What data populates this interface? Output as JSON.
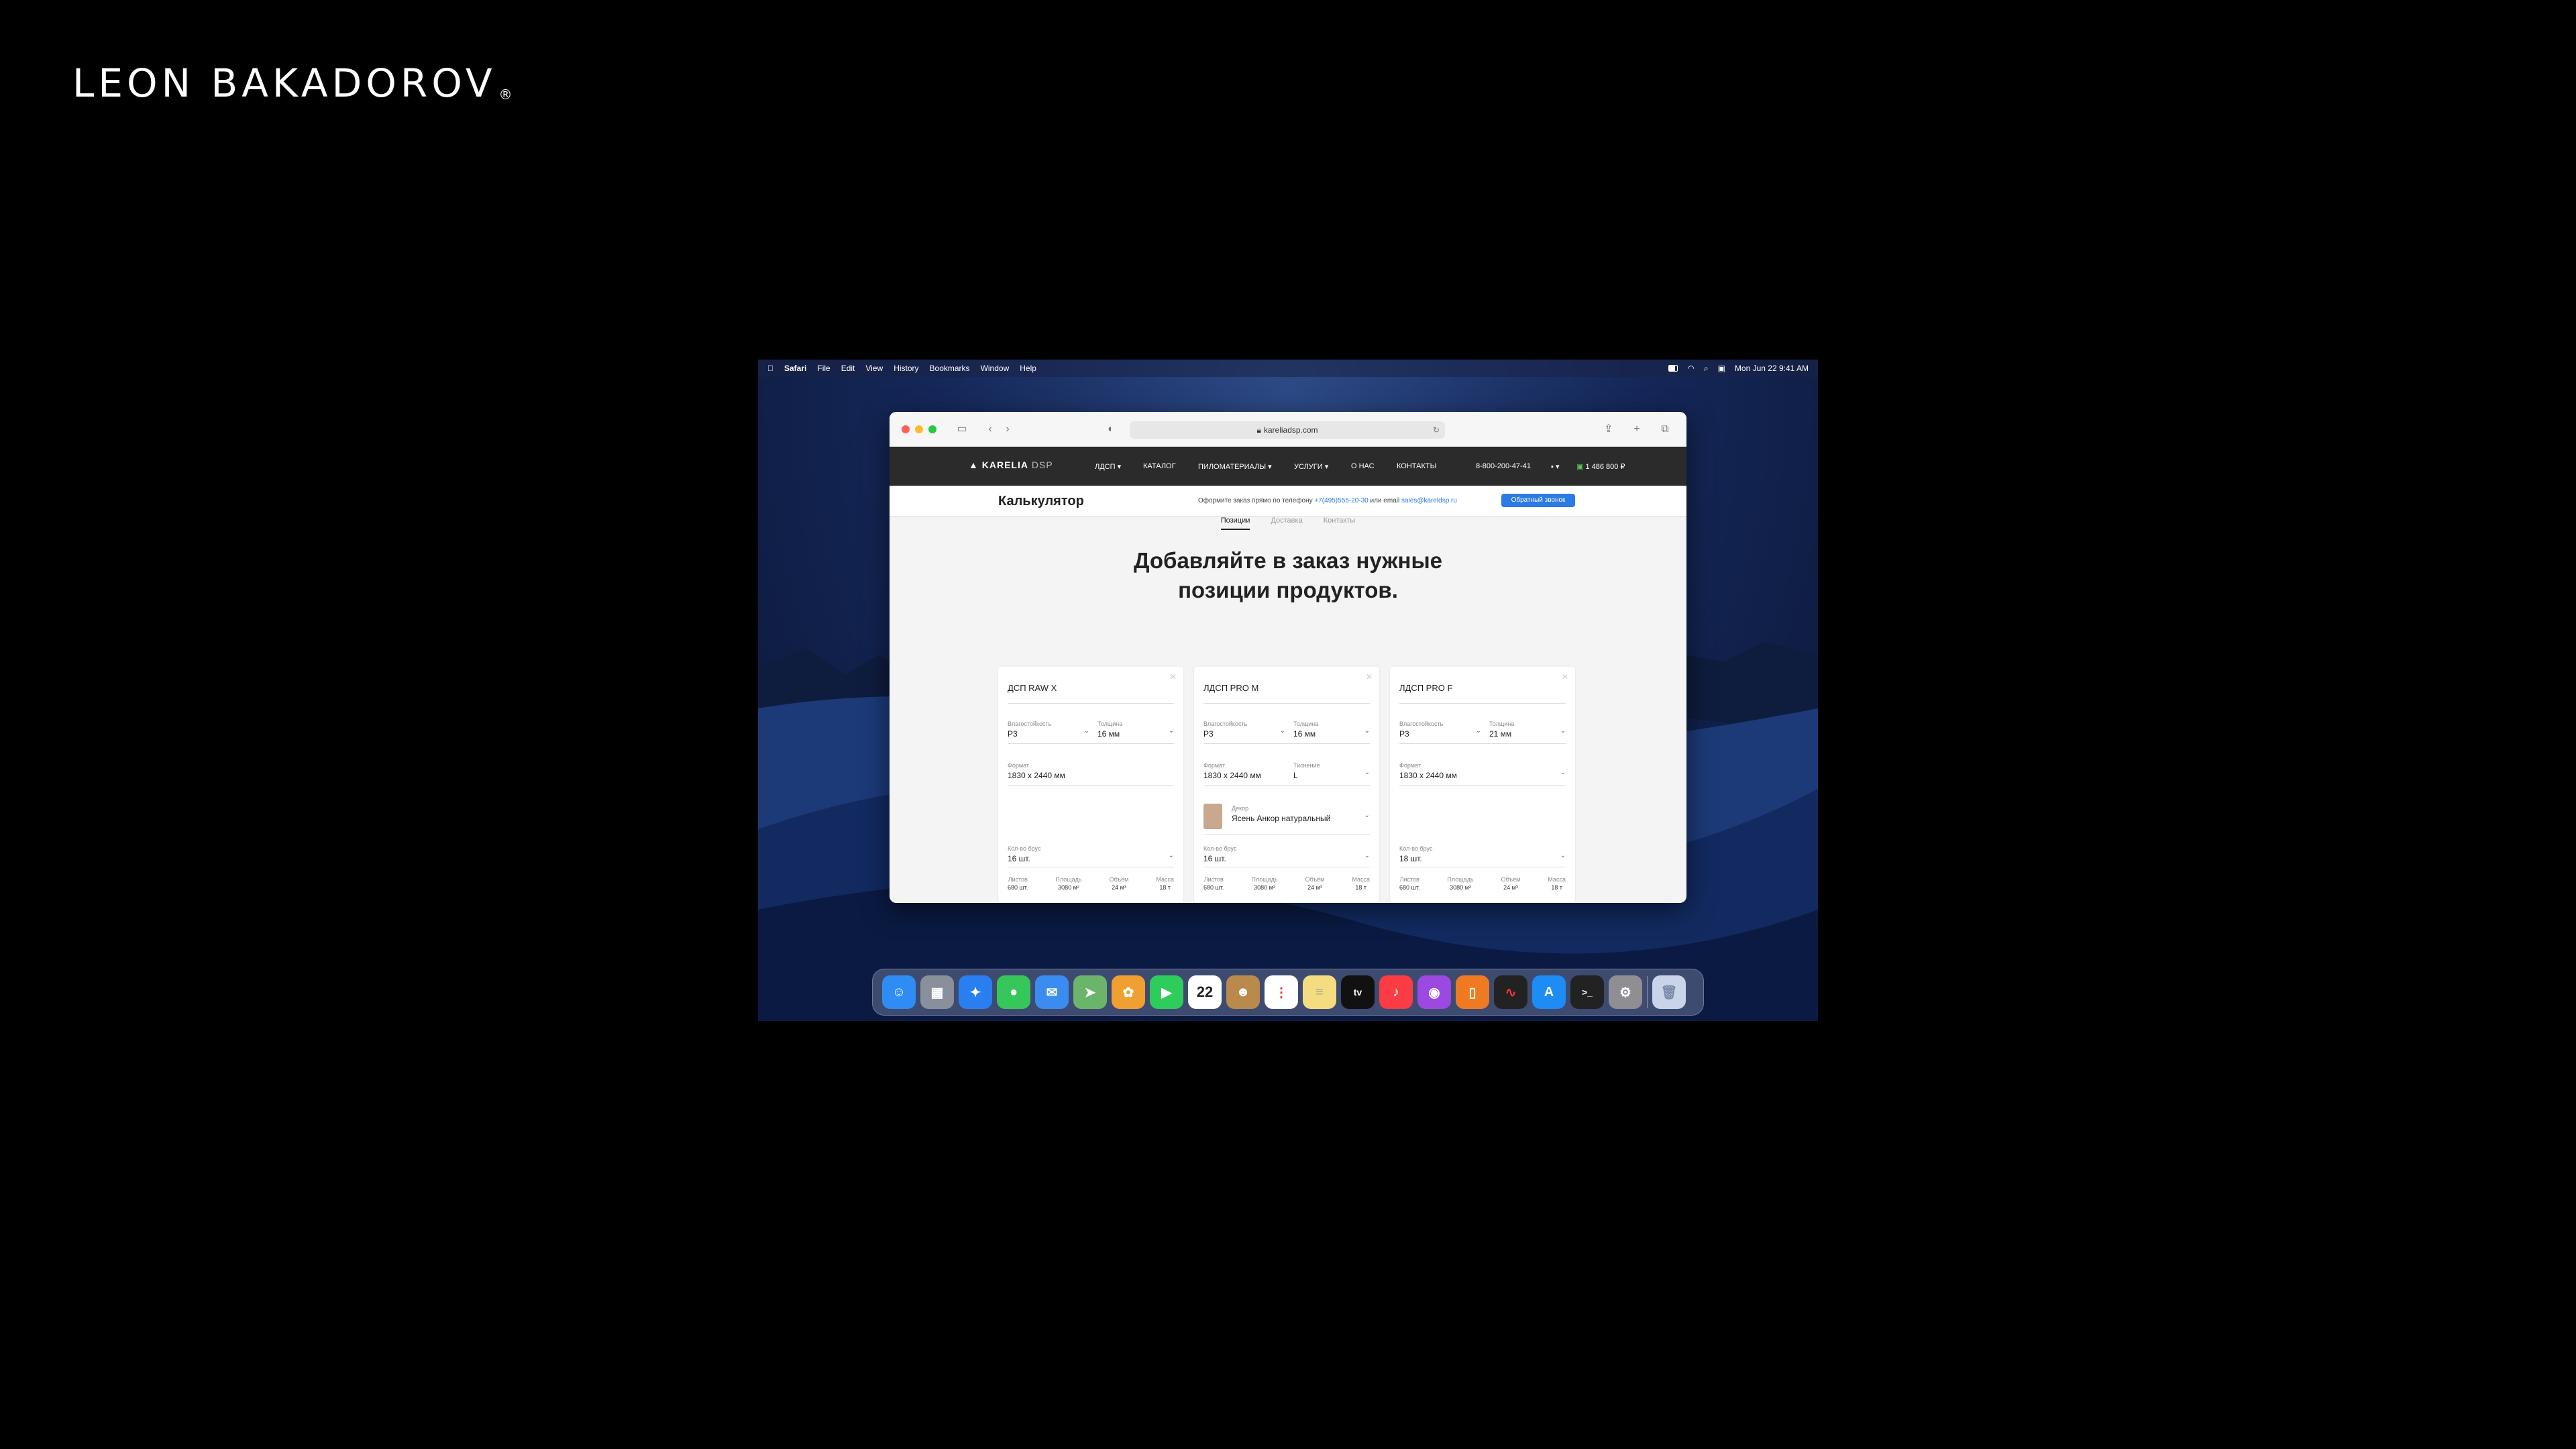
{
  "brand": {
    "name": "LEON BAKADOROV",
    "mark": "®"
  },
  "menubar": {
    "app": "Safari",
    "items": [
      "File",
      "Edit",
      "View",
      "History",
      "Bookmarks",
      "Window",
      "Help"
    ],
    "clock": "Mon Jun 22  9:41 AM"
  },
  "browser": {
    "url": "kareliadsp.com"
  },
  "site": {
    "logo": "KARELIA",
    "logo_suffix": "DSP",
    "nav": [
      "ЛДСП",
      "КАТАЛОГ",
      "ПИЛОМАТЕРИАЛЫ",
      "УСЛУГИ",
      "О НАС",
      "КОНТАКТЫ"
    ],
    "phone": "8-800-200-47-41",
    "cart": "1 486 800 ₽",
    "page_title": "Калькулятор",
    "order_note_prefix": "Оформите заказ прямо по телефону",
    "order_phone": "+7(495)555-20-30",
    "order_note_mid": "или email",
    "order_email": "sales@kareldsp.ru",
    "callback": "Обратный звонок",
    "tabs": [
      "Позиции",
      "Доставка",
      "Контакты"
    ],
    "headline_1": "Добавляйте в заказ нужные",
    "headline_2": "позиции продуктов."
  },
  "cards": [
    {
      "title": "ДСП RAW X",
      "moisture_label": "Влагостойкость",
      "moisture": "Р3",
      "thickness_label": "Толщина",
      "thickness": "16 мм",
      "format_label": "Формат",
      "format": "1830 х 2440 мм",
      "qty_label": "Кол-во брус",
      "qty": "16 шт.",
      "stats": [
        {
          "l": "Листов",
          "v": "680 шт."
        },
        {
          "l": "Площадь",
          "v": "3080 м²"
        },
        {
          "l": "Объём",
          "v": "24 м³"
        },
        {
          "l": "Масса",
          "v": "18 т"
        }
      ]
    },
    {
      "title": "ЛДСП PRO M",
      "moisture_label": "Влагостойкость",
      "moisture": "Р3",
      "thickness_label": "Толщина",
      "thickness": "16 мм",
      "format_label": "Формат",
      "format": "1830 х 2440 мм",
      "emboss_label": "Тиснение",
      "emboss": "L",
      "decor_label": "Декор",
      "decor": "Ясень Анкор натуральный",
      "qty_label": "Кол-во брус",
      "qty": "16 шт.",
      "stats": [
        {
          "l": "Листов",
          "v": "680 шт."
        },
        {
          "l": "Площадь",
          "v": "3080 м²"
        },
        {
          "l": "Объём",
          "v": "24 м³"
        },
        {
          "l": "Масса",
          "v": "18 т"
        }
      ]
    },
    {
      "title": "ЛДСП PRO F",
      "moisture_label": "Влагостойкость",
      "moisture": "Р3",
      "thickness_label": "Толщина",
      "thickness": "21 мм",
      "format_label": "Формат",
      "format": "1830 х 2440 мм",
      "qty_label": "Кол-во брус",
      "qty": "18 шт.",
      "stats": [
        {
          "l": "Листов",
          "v": "680 шт."
        },
        {
          "l": "Площадь",
          "v": "3080 м²"
        },
        {
          "l": "Объём",
          "v": "24 м³"
        },
        {
          "l": "Масса",
          "v": "18 т"
        }
      ]
    }
  ],
  "dock": {
    "calendar_day": "22",
    "tv_label": "tv",
    "colors": [
      "#2f8cf5",
      "#8a8f9c",
      "#2a7ff0",
      "#35c759",
      "#3b8cf0",
      "#6bb56b",
      "#f0a030",
      "#2ecc5a",
      "#ffffff",
      "#b98a4c",
      "#ffffff",
      "#f3dd80",
      "#111111",
      "#fc3c44",
      "#9b49e0",
      "#f07a21",
      "#222222",
      "#1d8cf5",
      "#222222",
      "#8e8e93",
      "#c9d4e8"
    ]
  }
}
